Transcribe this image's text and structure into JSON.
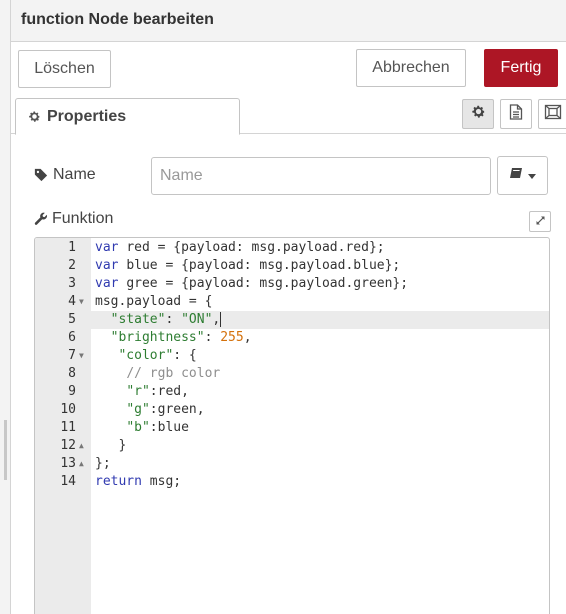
{
  "dialog": {
    "title": "function Node bearbeiten",
    "delete_label": "Löschen",
    "cancel_label": "Abbrechen",
    "done_label": "Fertig",
    "accent_color": "#ad1625"
  },
  "tabs": {
    "properties_label": "Properties",
    "icon_buttons": [
      "gear-icon",
      "description-icon",
      "appearance-icon"
    ]
  },
  "form": {
    "name_label": "Name",
    "name_placeholder": "Name",
    "name_value": "",
    "icon_select": "book-icon",
    "function_label": "Funktion"
  },
  "editor": {
    "active_line": 5,
    "lines": [
      {
        "n": "1",
        "fold": "",
        "tokens": [
          [
            "kw",
            "var"
          ],
          [
            "",
            "red = {payload: msg.payload.red};"
          ]
        ]
      },
      {
        "n": "2",
        "fold": "",
        "tokens": [
          [
            "kw",
            "var"
          ],
          [
            "",
            "blue = {payload: msg.payload.blue};"
          ]
        ]
      },
      {
        "n": "3",
        "fold": "",
        "tokens": [
          [
            "kw",
            "var"
          ],
          [
            "",
            "gree = {payload: msg.payload.green};"
          ]
        ]
      },
      {
        "n": "4",
        "fold": "▼",
        "tokens": [
          [
            "",
            "msg.payload = {"
          ]
        ]
      },
      {
        "n": "5",
        "fold": "",
        "tokens": [
          [
            "",
            "  "
          ],
          [
            "str",
            "\"state\""
          ],
          [
            "",
            ": "
          ],
          [
            "str",
            "\"ON\""
          ],
          [
            "",
            ","
          ]
        ]
      },
      {
        "n": "6",
        "fold": "",
        "tokens": [
          [
            "",
            "  "
          ],
          [
            "str",
            "\"brightness\""
          ],
          [
            "",
            ": "
          ],
          [
            "num-lit",
            "255"
          ],
          [
            "",
            ","
          ]
        ]
      },
      {
        "n": "7",
        "fold": "▼",
        "tokens": [
          [
            "",
            "   "
          ],
          [
            "str",
            "\"color\""
          ],
          [
            "",
            ": {"
          ]
        ]
      },
      {
        "n": "8",
        "fold": "",
        "tokens": [
          [
            "",
            "    "
          ],
          [
            "cmt",
            "// rgb color"
          ]
        ]
      },
      {
        "n": "9",
        "fold": "",
        "tokens": [
          [
            "",
            "    "
          ],
          [
            "str",
            "\"r\""
          ],
          [
            "",
            ":red,"
          ]
        ]
      },
      {
        "n": "10",
        "fold": "",
        "tokens": [
          [
            "",
            "    "
          ],
          [
            "str",
            "\"g\""
          ],
          [
            "",
            ":green,"
          ]
        ]
      },
      {
        "n": "11",
        "fold": "",
        "tokens": [
          [
            "",
            "    "
          ],
          [
            "str",
            "\"b\""
          ],
          [
            "",
            ":blue"
          ]
        ]
      },
      {
        "n": "12",
        "fold": "▲",
        "tokens": [
          [
            "",
            "   }"
          ]
        ]
      },
      {
        "n": "13",
        "fold": "▲",
        "tokens": [
          [
            "",
            "};"
          ]
        ]
      },
      {
        "n": "14",
        "fold": "",
        "tokens": [
          [
            "kw",
            "return"
          ],
          [
            "",
            " msg;"
          ]
        ]
      }
    ]
  }
}
